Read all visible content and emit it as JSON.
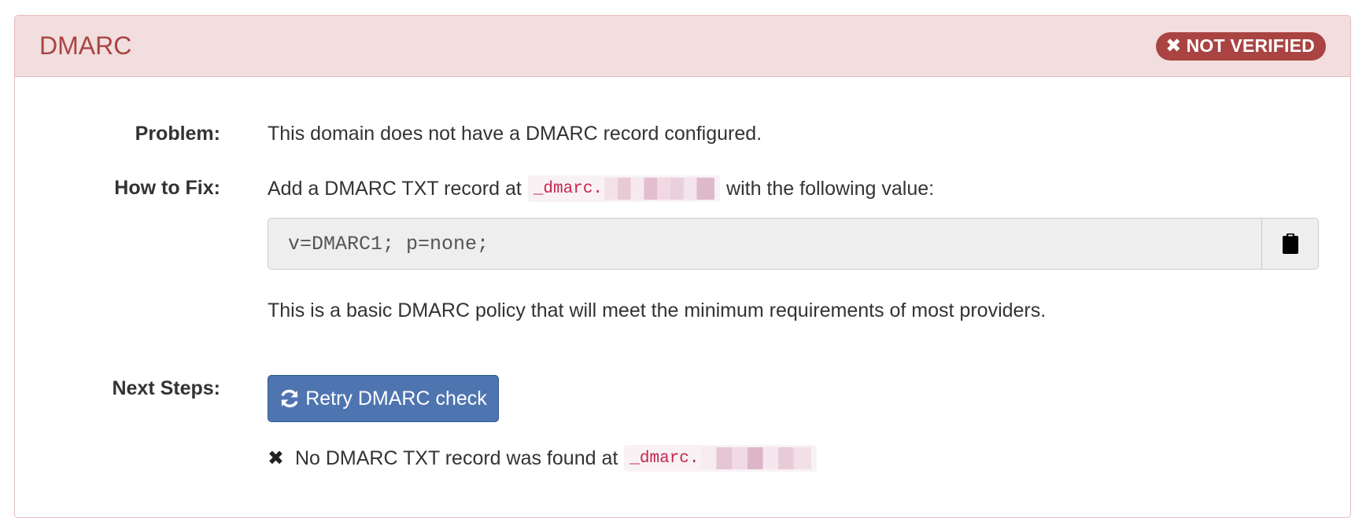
{
  "panel": {
    "title": "DMARC",
    "status_badge": {
      "icon": "times-icon",
      "label": "NOT VERIFIED",
      "color": "#a94442"
    }
  },
  "problem": {
    "label": "Problem:",
    "text": "This domain does not have a DMARC record configured."
  },
  "how_to_fix": {
    "label": "How to Fix:",
    "text_before": "Add a DMARC TXT record at",
    "record_prefix": "_dmarc.",
    "text_after": "with the following value:",
    "record_value": "v=DMARC1; p=none;",
    "copy_icon": "clipboard-icon",
    "note": "This is a basic DMARC policy that will meet the minimum requirements of most providers."
  },
  "next_steps": {
    "label": "Next Steps:",
    "retry_button": {
      "icon": "refresh-icon",
      "label": "Retry DMARC check",
      "color": "#4f75b0"
    },
    "result_icon": "times-icon",
    "result_text": "No DMARC TXT record was found at",
    "result_record_prefix": "_dmarc."
  }
}
